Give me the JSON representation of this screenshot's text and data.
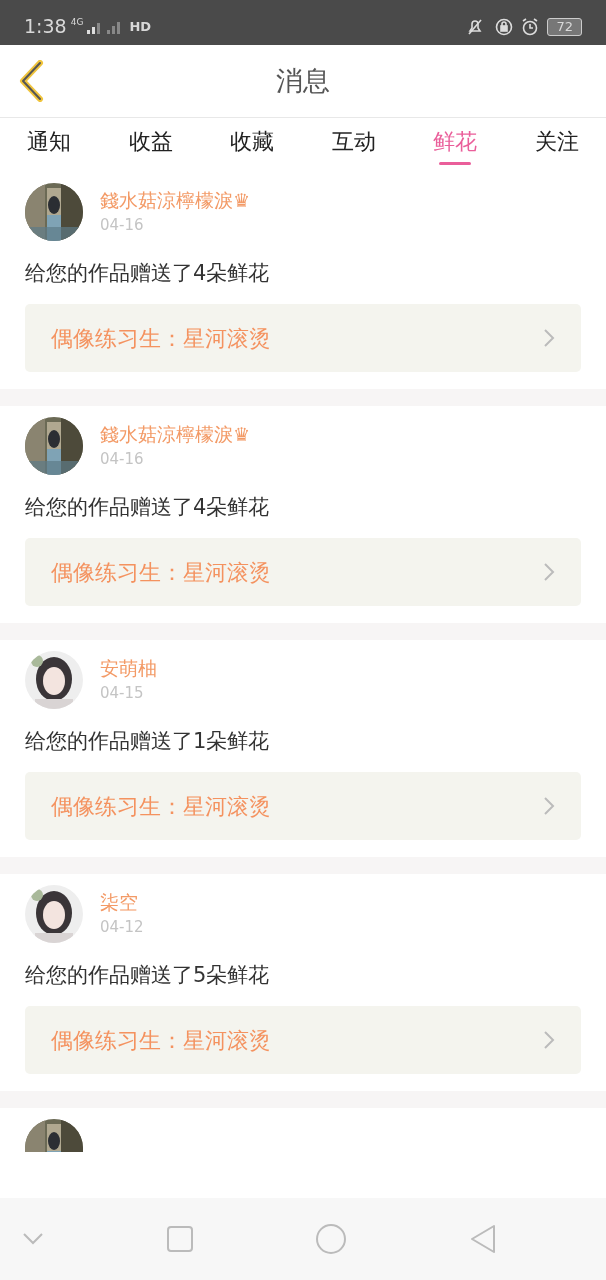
{
  "status_bar": {
    "time": "1:38",
    "network": "4G",
    "hd": "HD",
    "battery": "72"
  },
  "header": {
    "title": "消息"
  },
  "tabs": [
    {
      "label": "通知",
      "selected": false
    },
    {
      "label": "收益",
      "selected": false
    },
    {
      "label": "收藏",
      "selected": false
    },
    {
      "label": "互动",
      "selected": false
    },
    {
      "label": "鲜花",
      "selected": true
    },
    {
      "label": "关注",
      "selected": false
    }
  ],
  "messages": [
    {
      "user": "錢水菇涼檸檬淚♛",
      "date": "04-16",
      "text": "给您的作品赠送了4朵鲜花",
      "work": "偶像练习生：星河滚烫"
    },
    {
      "user": "錢水菇涼檸檬淚♛",
      "date": "04-16",
      "text": "给您的作品赠送了4朵鲜花",
      "work": "偶像练习生：星河滚烫"
    },
    {
      "user": "安萌柚",
      "date": "04-15",
      "text": "给您的作品赠送了1朵鲜花",
      "work": "偶像练习生：星河滚烫"
    },
    {
      "user": "柒空",
      "date": "04-12",
      "text": "给您的作品赠送了5朵鲜花",
      "work": "偶像练习生：星河滚烫"
    }
  ]
}
